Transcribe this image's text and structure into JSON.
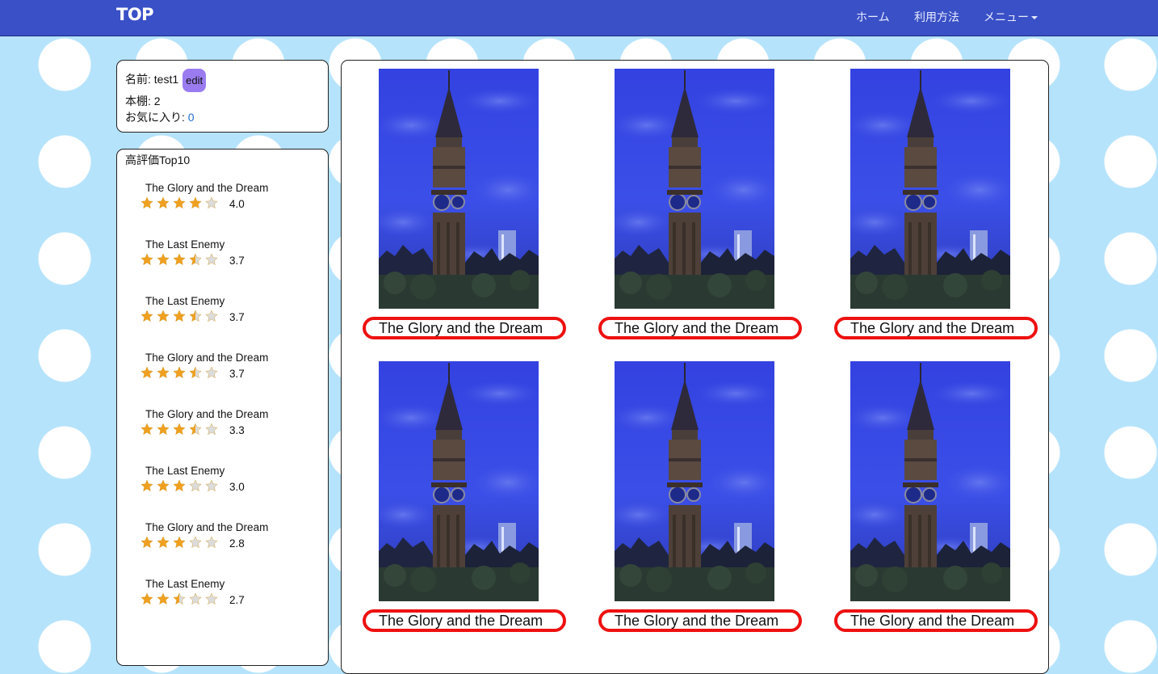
{
  "nav": {
    "brand": "TOP",
    "home": "ホーム",
    "howto": "利用方法",
    "menu": "メニュー"
  },
  "profile": {
    "name_label": "名前: test1",
    "edit_label": "edit",
    "shelves_label": "本棚:  2",
    "favorites_label": "お気に入り: ",
    "favorites_count": "0"
  },
  "ranking": {
    "title": "高評価Top10",
    "items": [
      {
        "title": "The Glory and the Dream",
        "score": "4.0",
        "rating": 4.0
      },
      {
        "title": "The Last Enemy",
        "score": "3.7",
        "rating": 3.5
      },
      {
        "title": "The Last Enemy",
        "score": "3.7",
        "rating": 3.5
      },
      {
        "title": "The Glory and the Dream",
        "score": "3.7",
        "rating": 3.5
      },
      {
        "title": "The Glory and the Dream",
        "score": "3.3",
        "rating": 3.5
      },
      {
        "title": "The Last Enemy",
        "score": "3.0",
        "rating": 3.0
      },
      {
        "title": "The Glory and the Dream",
        "score": "2.8",
        "rating": 3.0
      },
      {
        "title": "The Last Enemy",
        "score": "2.7",
        "rating": 2.5
      }
    ]
  },
  "books": [
    {
      "title": "The Glory and the Dream"
    },
    {
      "title": "The Glory and the Dream"
    },
    {
      "title": "The Glory and the Dream"
    },
    {
      "title": "The Glory and the Dream"
    },
    {
      "title": "The Glory and the Dream"
    },
    {
      "title": "The Glory and the Dream"
    }
  ],
  "colors": {
    "navbar": "#3a50c6",
    "background": "#b5e3fb",
    "edit_button": "#9b7cf0",
    "title_border": "#ee1111",
    "star": "#f0a020"
  }
}
